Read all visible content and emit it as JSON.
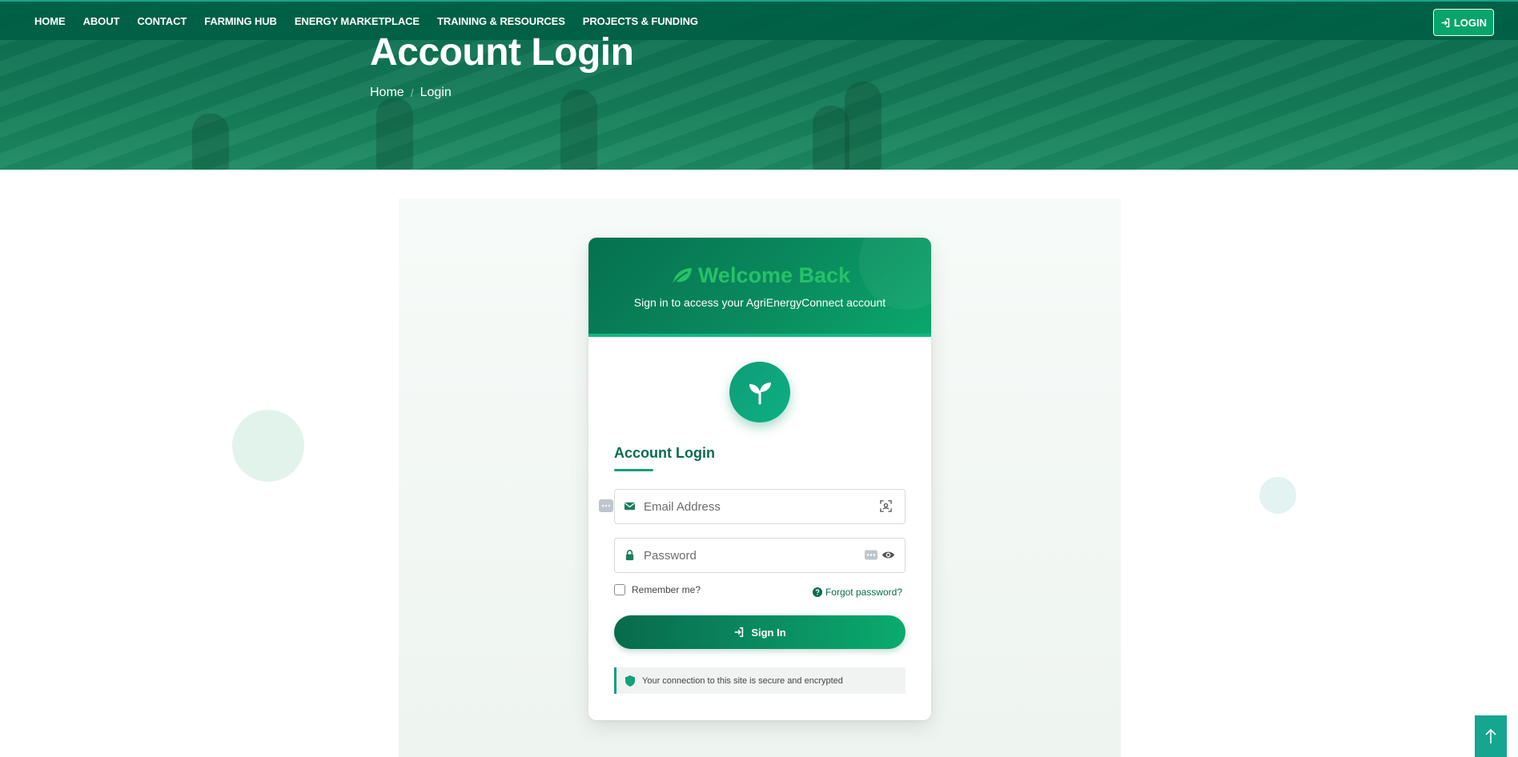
{
  "nav": {
    "items": [
      {
        "label": "HOME"
      },
      {
        "label": "ABOUT"
      },
      {
        "label": "CONTACT"
      },
      {
        "label": "FARMING HUB"
      },
      {
        "label": "ENERGY MARKETPLACE"
      },
      {
        "label": "TRAINING & RESOURCES"
      },
      {
        "label": "PROJECTS & FUNDING"
      }
    ],
    "login_label": "LOGIN"
  },
  "hero": {
    "title": "Account Login",
    "breadcrumb": [
      "Home",
      "Login"
    ]
  },
  "card": {
    "welcome": "Welcome Back",
    "subtitle": "Sign in to access your AgriEnergyConnect account",
    "form_title": "Account Login",
    "email_placeholder": "Email Address",
    "password_placeholder": "Password",
    "remember_label": "Remember me?",
    "forgot_label": "Forgot password?",
    "signin_label": "Sign In",
    "secure_note": "Your connection to this site is secure and encrypted"
  },
  "colors": {
    "brand_dark": "#0a6b4f",
    "brand": "#0ba76c",
    "accent_teal": "#16a58f",
    "welcome_text": "#27c167"
  },
  "icons": {
    "nav_login": "login-arrow-icon",
    "welcome": "leaf-icon",
    "avatar": "seedling-icon",
    "email": "envelope-icon",
    "password": "lock-icon",
    "email_trailing": "autofill-scan-icon",
    "password_trailing": [
      "password-manager-icon",
      "eye-icon"
    ],
    "forgot": "question-circle-icon",
    "signin": "sign-in-icon",
    "secure": "shield-icon",
    "scroll_top": "arrow-up-icon"
  }
}
